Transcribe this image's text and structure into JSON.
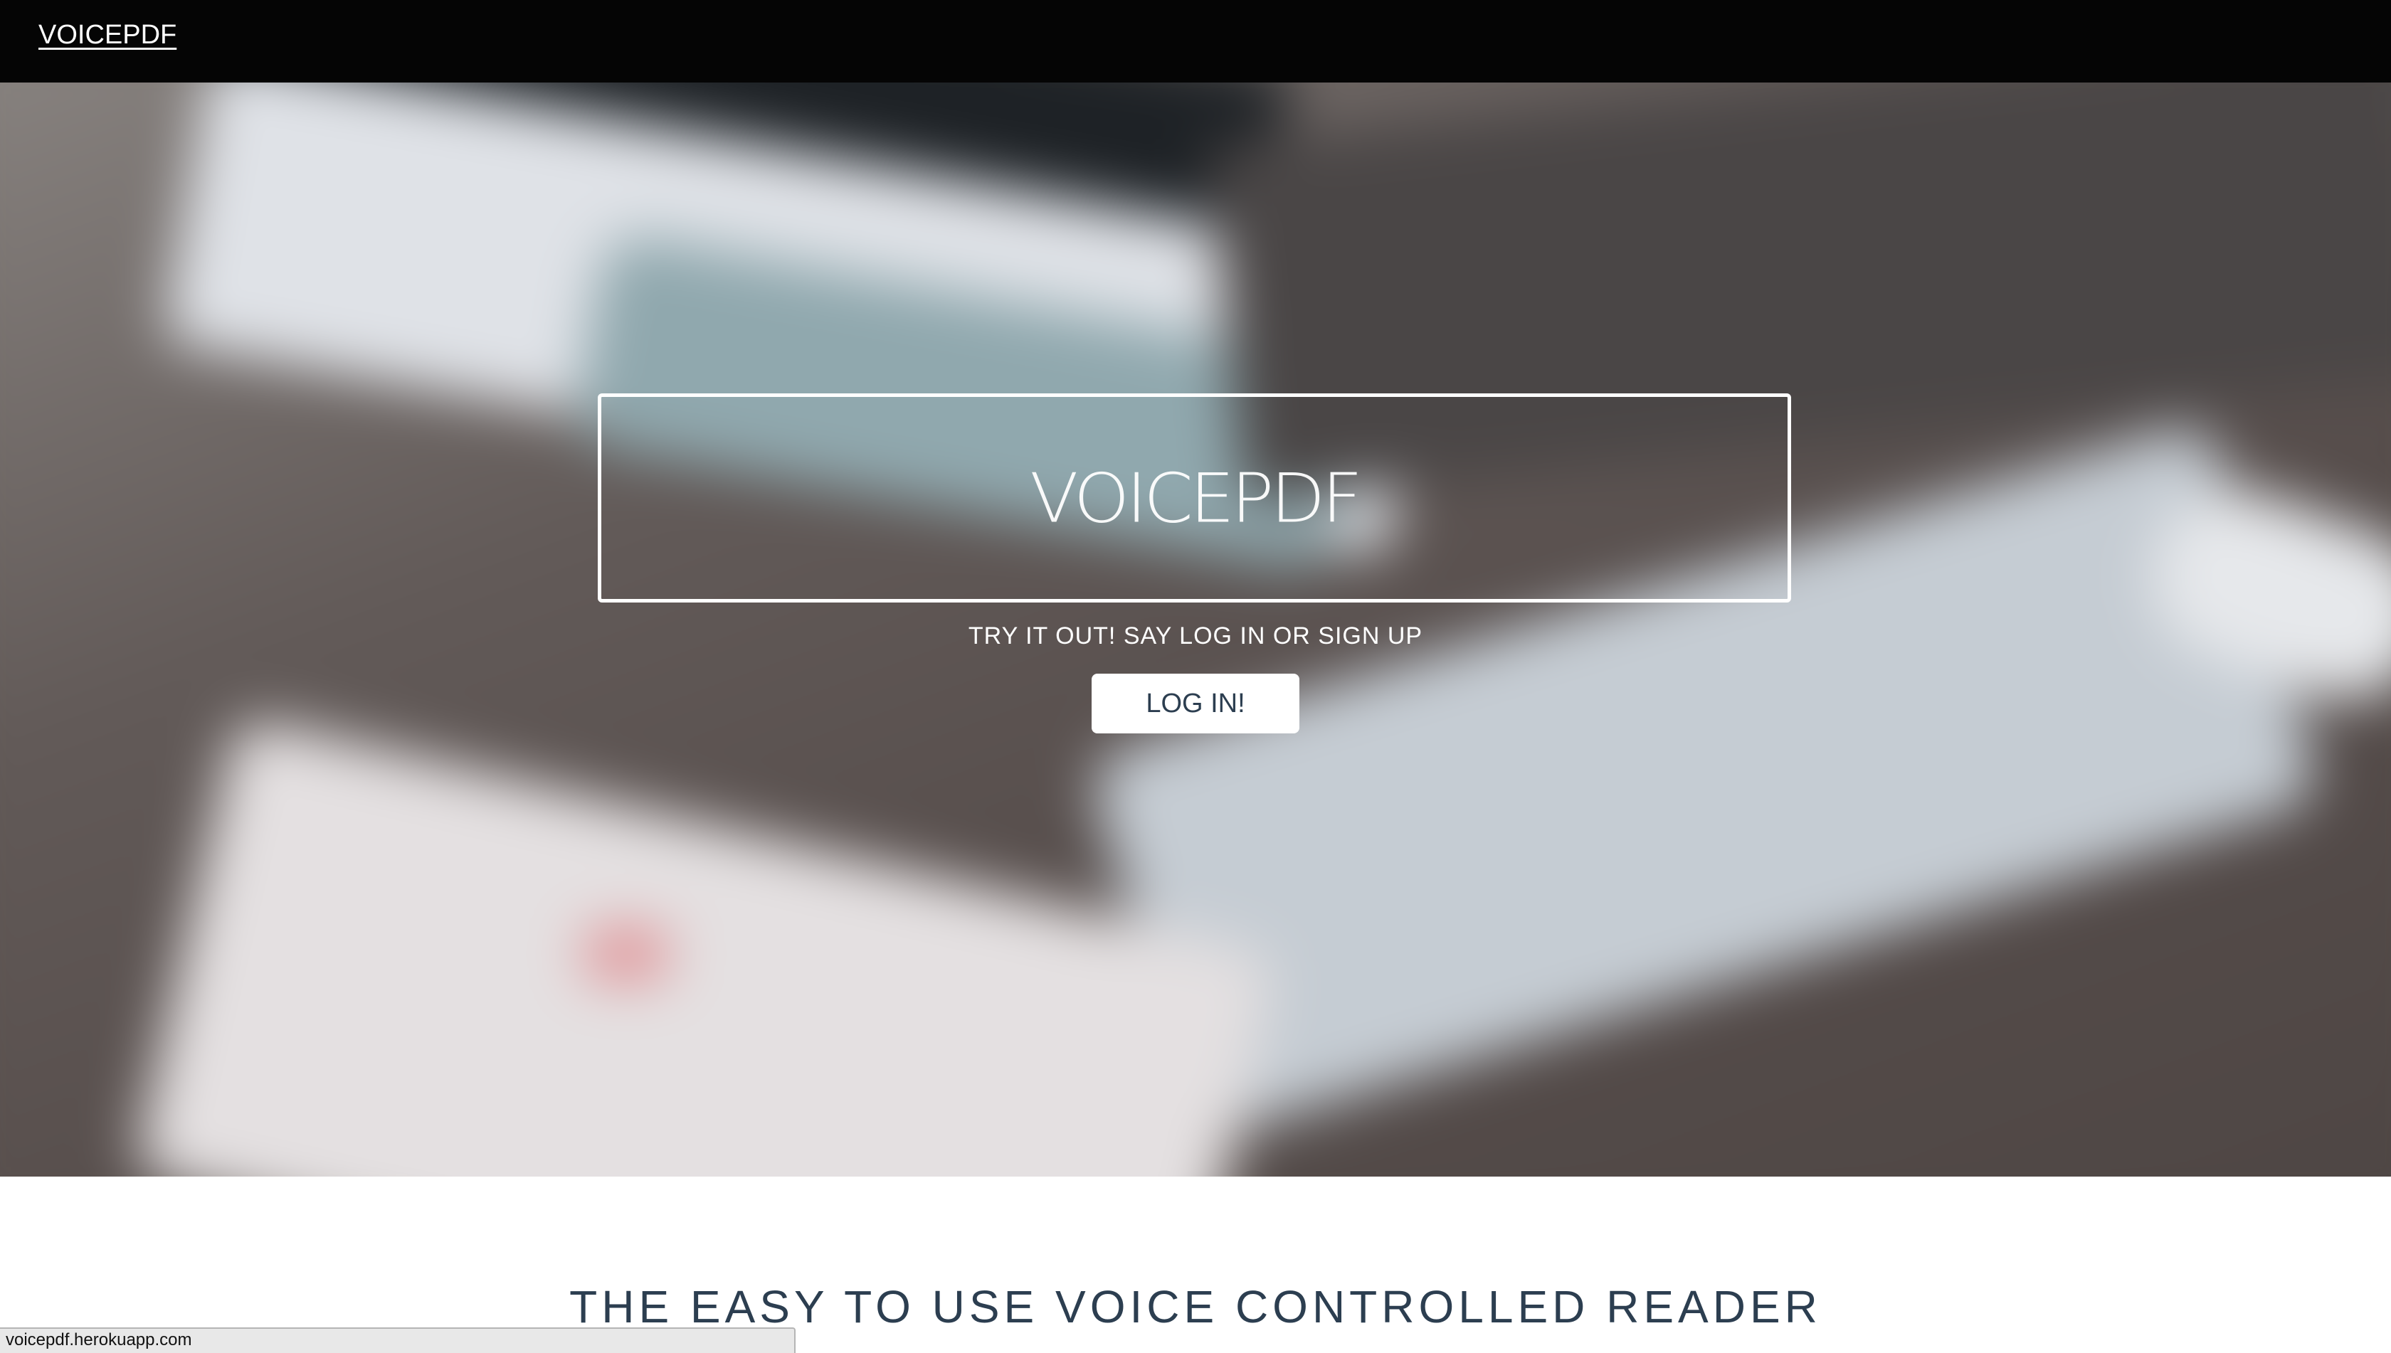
{
  "navbar": {
    "brand_label": "VOICEPDF"
  },
  "hero": {
    "title": "VOICEPDF",
    "tagline": "TRY IT OUT! SAY LOG IN OR SIGN UP",
    "login_button_label": "LOG IN!"
  },
  "section": {
    "heading": "THE EASY TO USE VOICE CONTROLLED READER"
  },
  "status_bar": {
    "url": "voicepdf.herokuapp.com"
  },
  "colors": {
    "navbar_bg": "#050505",
    "heading_text": "#2c3e50",
    "button_bg": "#ffffff"
  }
}
